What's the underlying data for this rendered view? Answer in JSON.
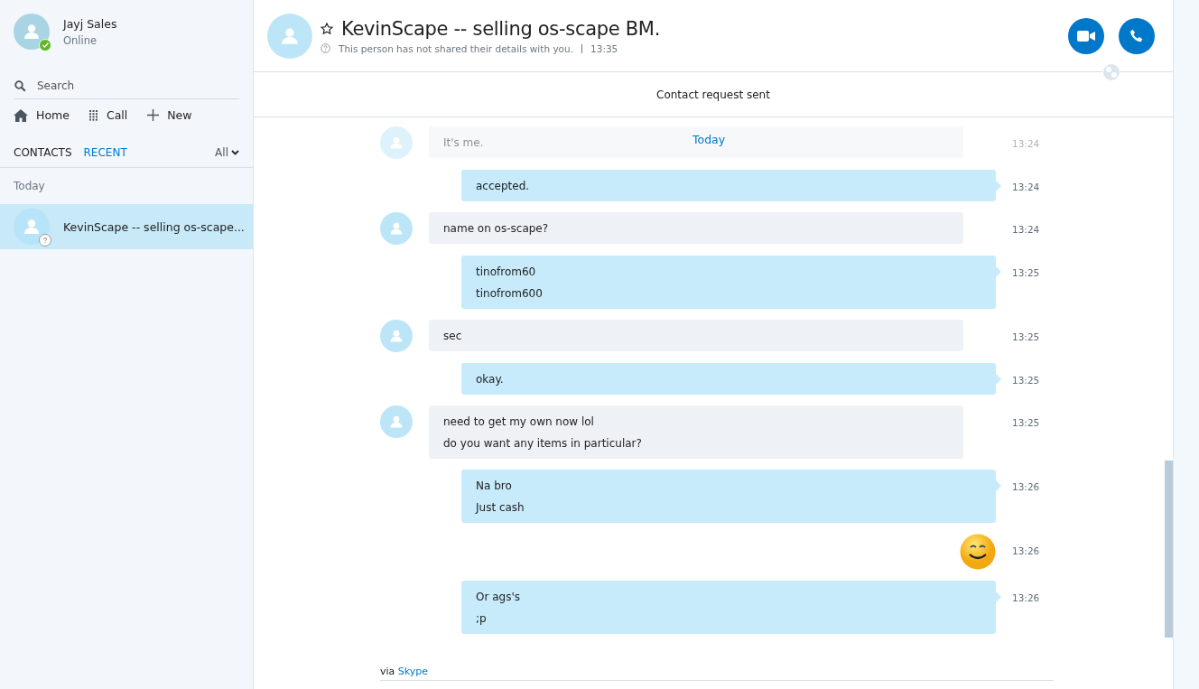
{
  "profile": {
    "name": "Jayj Sales",
    "status": "Online"
  },
  "search": {
    "placeholder": "Search"
  },
  "nav": [
    {
      "label": "Home",
      "kind": "home"
    },
    {
      "label": "Call",
      "kind": "dialpad"
    },
    {
      "label": "New",
      "kind": "plus"
    }
  ],
  "tabs": [
    {
      "label": "CONTACTS",
      "selected": false
    },
    {
      "label": "RECENT",
      "selected": true
    }
  ],
  "filter": "All",
  "section": "Today",
  "conversations": [
    {
      "name": "KevinScape -- selling os-scape...",
      "selected": true
    }
  ],
  "chat": {
    "title": "KevinScape -- selling os-scape BM.",
    "subtitle": "This person has not shared their details with you.",
    "time": "13:35",
    "notice": "Contact request sent",
    "day": "Today",
    "messages": [
      {
        "kind": "faded",
        "lines": [
          "It's me."
        ],
        "time": "13:24"
      },
      {
        "kind": "outgoing",
        "lines": [
          "accepted."
        ],
        "time": "13:24"
      },
      {
        "kind": "incoming",
        "lines": [
          "name on os-scape?"
        ],
        "time": "13:24"
      },
      {
        "kind": "outgoing",
        "lines": [
          "tinofrom60",
          "tinofrom600"
        ],
        "time": "13:25"
      },
      {
        "kind": "incoming",
        "lines": [
          "sec"
        ],
        "time": "13:25"
      },
      {
        "kind": "outgoing",
        "lines": [
          "okay."
        ],
        "time": "13:25"
      },
      {
        "kind": "incoming",
        "lines": [
          "need to get my own now lol",
          "do you want any items in particular?"
        ],
        "time": "13:25"
      },
      {
        "kind": "outgoing",
        "lines": [
          "Na bro",
          "Just cash"
        ],
        "time": "13:26"
      },
      {
        "kind": "emoji",
        "time": "13:26"
      },
      {
        "kind": "outgoing",
        "lines": [
          "Or ags's",
          ";p"
        ],
        "time": "13:26"
      }
    ],
    "footer": {
      "prefix": "via",
      "link": "Skype"
    }
  }
}
